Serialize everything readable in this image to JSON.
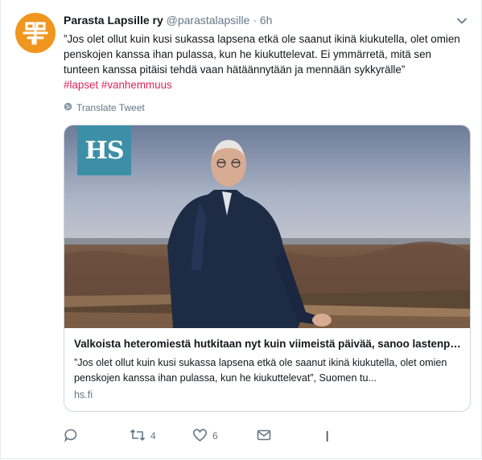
{
  "tweet": {
    "author_name": "Parasta Lapsille ry",
    "handle": "@parastalapsille",
    "separator": "·",
    "time": "6h",
    "text": "”Jos olet ollut kuin kusi sukassa lapsena etkä ole saanut ikinä kiukutella, olet omien penskojen kanssa ihan pulassa, kun he kiukuttelevat. Ei ymmärretä, mitä sen tunteen kanssa pitäisi tehdä vaan hätäännytään ja mennään sykkyrälle”",
    "hashtags": "#lapset #vanhemmuus",
    "translate_label": "Translate Tweet"
  },
  "card": {
    "logo_text": "HS",
    "title": "Valkoista heteromiestä hutkitaan nyt kuin viimeistä päivää, sanoo lastenpsykiatri",
    "description": "”Jos olet ollut kuin kusi sukassa lapsena etkä ole saanut ikinä kiukutella, olet omien penskojen kanssa ihan pulassa, kun he kiukuttelevat”, Suomen tu...",
    "domain": "hs.fi"
  },
  "actions": {
    "reply_count": "",
    "retweet_count": "4",
    "like_count": "6"
  },
  "colors": {
    "avatar_bg": "#f0951e",
    "hashtag": "#e0245e",
    "muted": "#657786",
    "hs_logo_bg": "#3d8fa8"
  },
  "icons": [
    "avatar-logo",
    "chevron-down-icon",
    "globe-icon",
    "reply-icon",
    "retweet-icon",
    "like-icon",
    "message-icon"
  ]
}
